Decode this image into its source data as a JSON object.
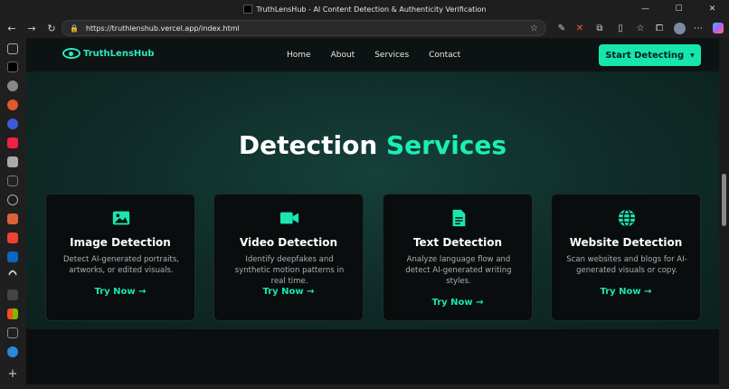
{
  "browser": {
    "window_title": "TruthLensHub - AI Content Detection & Authenticity Verification",
    "url": "https://truthlenshub.vercel.app/index.html"
  },
  "site": {
    "logo": "TruthLensHub",
    "nav": [
      "Home",
      "About",
      "Services",
      "Contact"
    ],
    "cta": "Start Detecting"
  },
  "hero": {
    "title_main": "Detection",
    "title_accent": "Services"
  },
  "cards": [
    {
      "icon": "image-icon",
      "title": "Image Detection",
      "desc": "Detect AI-generated portraits, artworks, or edited visuals.",
      "link": "Try Now →"
    },
    {
      "icon": "video-icon",
      "title": "Video Detection",
      "desc": "Identify deepfakes and synthetic motion patterns in real time.",
      "link": "Try Now →"
    },
    {
      "icon": "document-icon",
      "title": "Text Detection",
      "desc": "Analyze language flow and detect AI-generated writing styles.",
      "link": "Try Now →"
    },
    {
      "icon": "globe-icon",
      "title": "Website Detection",
      "desc": "Scan websites and blogs for AI-generated visuals or copy.",
      "link": "Try Now →"
    }
  ],
  "colors": {
    "accent": "#19e6b0",
    "background": "#0d1413"
  }
}
